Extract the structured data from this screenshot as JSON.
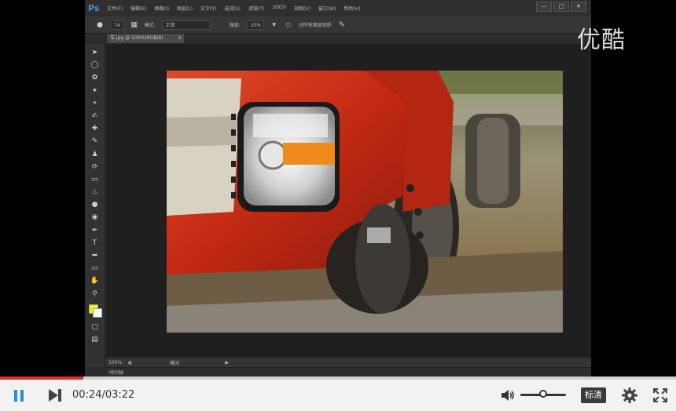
{
  "photoshop": {
    "logo": "Ps",
    "menu": [
      "文件(F)",
      "编辑(E)",
      "图像(I)",
      "图层(L)",
      "文字(Y)",
      "选择(S)",
      "滤镜(T)",
      "3D(D)",
      "视图(V)",
      "窗口(W)",
      "帮助(H)"
    ],
    "window_buttons": {
      "minimize": "—",
      "maximize": "□",
      "close": "✕"
    },
    "options_bar": {
      "brush_size": "74",
      "mode_label": "模式:",
      "mode_value": "正常",
      "strength_label": "强度:",
      "strength_value": "50%",
      "sample_all_layers": "对所有图层取样"
    },
    "document_tab": {
      "title": "车.jpg @ 100%(RGB/8)",
      "close": "×"
    },
    "status": {
      "zoom": "100%",
      "label": "曝光",
      "arrow": "▶"
    },
    "timeline_tab": "时间轴",
    "foreground_color": "#f2f21a",
    "background_color": "#ffffff"
  },
  "watermark": "优酷",
  "player": {
    "current_time": "00:24",
    "separator": "/",
    "duration": "03:22",
    "progress": 0.123,
    "volume": 0.45,
    "quality_label": "标清",
    "accent_color": "#2a8dd8",
    "progress_color": "#e52d27"
  }
}
